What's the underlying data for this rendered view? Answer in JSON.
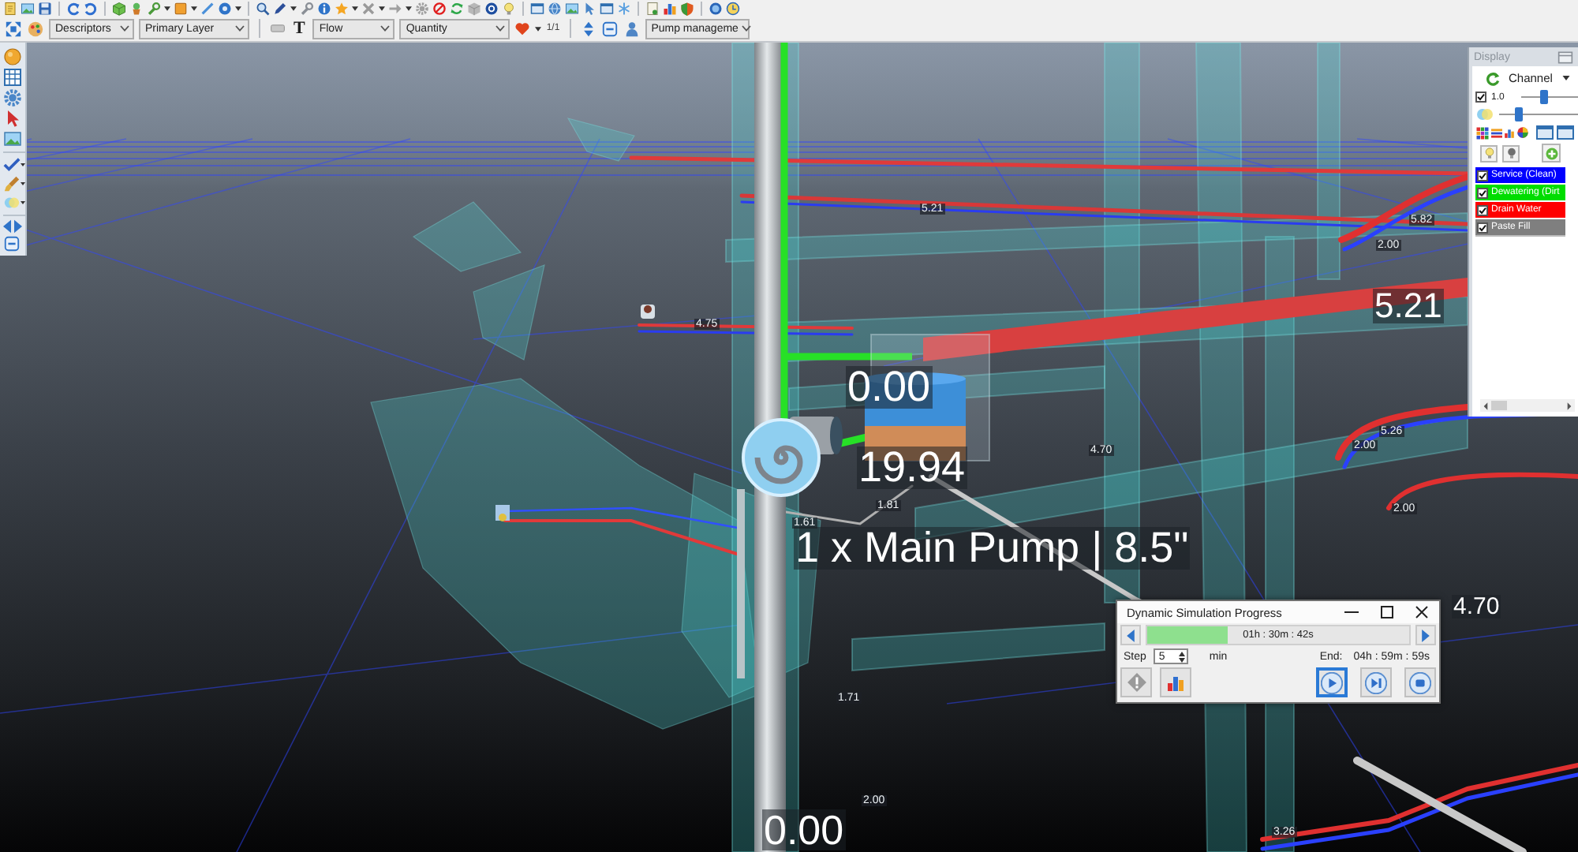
{
  "toolbar": {
    "layer_selects": [
      "Descriptors",
      "Primary Layer"
    ],
    "text_tool": "T",
    "label_selects": [
      "Flow",
      "Quantity"
    ],
    "color_scale": "1/1",
    "view_select": "Pump manageme"
  },
  "scene": {
    "labels": [
      "5.21",
      "5.82",
      "2.00",
      "5.21",
      "4.75",
      "0.00",
      "5.26",
      "2.00",
      "4.70",
      "19.94",
      "1.81",
      "2.00",
      "1.61",
      "1 x Main Pump | 8.5\"",
      "4.70",
      "1.71",
      "2.00",
      "3.26",
      "0.00"
    ]
  },
  "display_panel": {
    "title": "Display",
    "mode_select": "Channel",
    "scale_check": {
      "label": "1.0",
      "checked": true
    },
    "sliders": [
      {
        "level": 0.4
      },
      {
        "level": 0.22
      }
    ],
    "legend": [
      {
        "label": "Service (Clean)",
        "checked": true,
        "color": "#0000ff"
      },
      {
        "label": "Dewatering (Dirt",
        "checked": true,
        "color": "#00dd00"
      },
      {
        "label": "Drain Water",
        "checked": true,
        "color": "#ff0000"
      },
      {
        "label": "Paste Fill",
        "checked": true,
        "color": "#7f7f7f"
      }
    ]
  },
  "dialog": {
    "title": "Dynamic Simulation Progress",
    "progress": {
      "level": 0.31,
      "elapsed": "01h : 30m : 42s"
    },
    "step_label": "Step",
    "step_value": "5",
    "step_unit": "min",
    "end_label": "End:",
    "end_time": "04h : 59m : 59s",
    "transport": [
      {
        "kind": "play",
        "focused": true
      },
      {
        "kind": "step",
        "focused": false
      },
      {
        "kind": "stop",
        "focused": false
      }
    ]
  }
}
